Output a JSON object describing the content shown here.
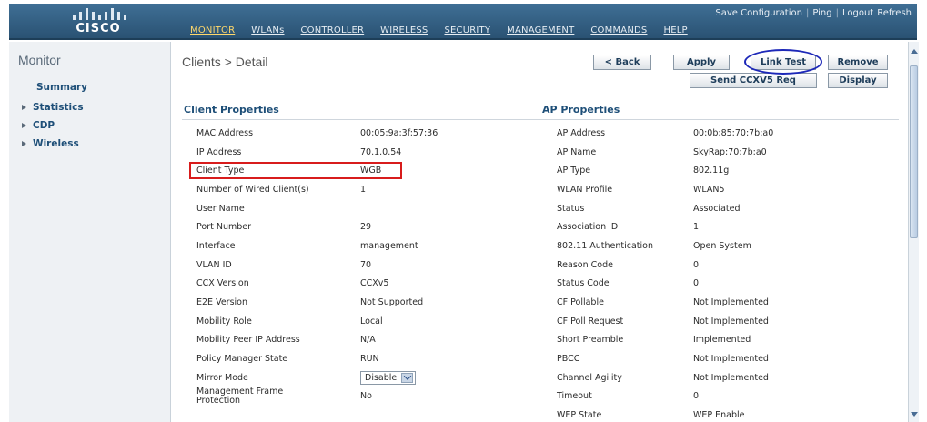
{
  "brand": {
    "logo_text": "CISCO"
  },
  "utility_links": [
    {
      "label": "Save Configuration"
    },
    {
      "label": "Ping"
    },
    {
      "label": "Logout"
    },
    {
      "label": "Refresh"
    }
  ],
  "nav": {
    "items": [
      {
        "label": "MONITOR",
        "active": true
      },
      {
        "label": "WLANs"
      },
      {
        "label": "CONTROLLER"
      },
      {
        "label": "WIRELESS"
      },
      {
        "label": "SECURITY"
      },
      {
        "label": "MANAGEMENT"
      },
      {
        "label": "COMMANDS"
      },
      {
        "label": "HELP"
      }
    ]
  },
  "sidebar": {
    "title": "Monitor",
    "summary": "Summary",
    "items": [
      {
        "label": "Statistics"
      },
      {
        "label": "CDP"
      },
      {
        "label": "Wireless"
      }
    ]
  },
  "main": {
    "title": "Clients > Detail",
    "buttons": {
      "back": "< Back",
      "apply": "Apply",
      "link_test": "Link Test",
      "remove": "Remove",
      "send_ccxv5": "Send CCXV5 Req",
      "display": "Display"
    },
    "client_properties": {
      "heading": "Client Properties",
      "rows": [
        {
          "label": "MAC Address",
          "value": "00:05:9a:3f:57:36"
        },
        {
          "label": "IP Address",
          "value": "70.1.0.54"
        },
        {
          "label": "Client Type",
          "value": "WGB"
        },
        {
          "label": "Number of Wired Client(s)",
          "value": "1"
        },
        {
          "label": "User Name",
          "value": ""
        },
        {
          "label": "Port Number",
          "value": "29"
        },
        {
          "label": "Interface",
          "value": "management"
        },
        {
          "label": "VLAN ID",
          "value": "70"
        },
        {
          "label": "CCX Version",
          "value": "CCXv5"
        },
        {
          "label": "E2E Version",
          "value": "Not Supported"
        },
        {
          "label": "Mobility Role",
          "value": "Local"
        },
        {
          "label": "Mobility Peer IP Address",
          "value": "N/A"
        },
        {
          "label": "Policy Manager State",
          "value": "RUN"
        },
        {
          "label": "Mirror Mode",
          "value": "Disable"
        },
        {
          "label": "Management Frame Protection",
          "value": "No"
        }
      ]
    },
    "ap_properties": {
      "heading": "AP Properties",
      "rows": [
        {
          "label": "AP Address",
          "value": "00:0b:85:70:7b:a0"
        },
        {
          "label": "AP Name",
          "value": "SkyRap:70:7b:a0"
        },
        {
          "label": "AP Type",
          "value": "802.11g"
        },
        {
          "label": "WLAN Profile",
          "value": "WLAN5"
        },
        {
          "label": "Status",
          "value": "Associated"
        },
        {
          "label": "Association ID",
          "value": "1"
        },
        {
          "label": "802.11 Authentication",
          "value": "Open System"
        },
        {
          "label": "Reason Code",
          "value": "0"
        },
        {
          "label": "Status Code",
          "value": "0"
        },
        {
          "label": "CF Pollable",
          "value": "Not Implemented"
        },
        {
          "label": "CF Poll Request",
          "value": "Not Implemented"
        },
        {
          "label": "Short Preamble",
          "value": "Implemented"
        },
        {
          "label": "PBCC",
          "value": "Not Implemented"
        },
        {
          "label": "Channel Agility",
          "value": "Not Implemented"
        },
        {
          "label": "Timeout",
          "value": "0"
        },
        {
          "label": "WEP State",
          "value": "WEP Enable"
        }
      ]
    }
  },
  "colors": {
    "header_bg": "#2f5d82",
    "active_nav": "#ffd86b",
    "heading_blue": "#1e4f78",
    "highlight_red": "#d81c1c",
    "highlight_blue": "#1d28b8"
  }
}
